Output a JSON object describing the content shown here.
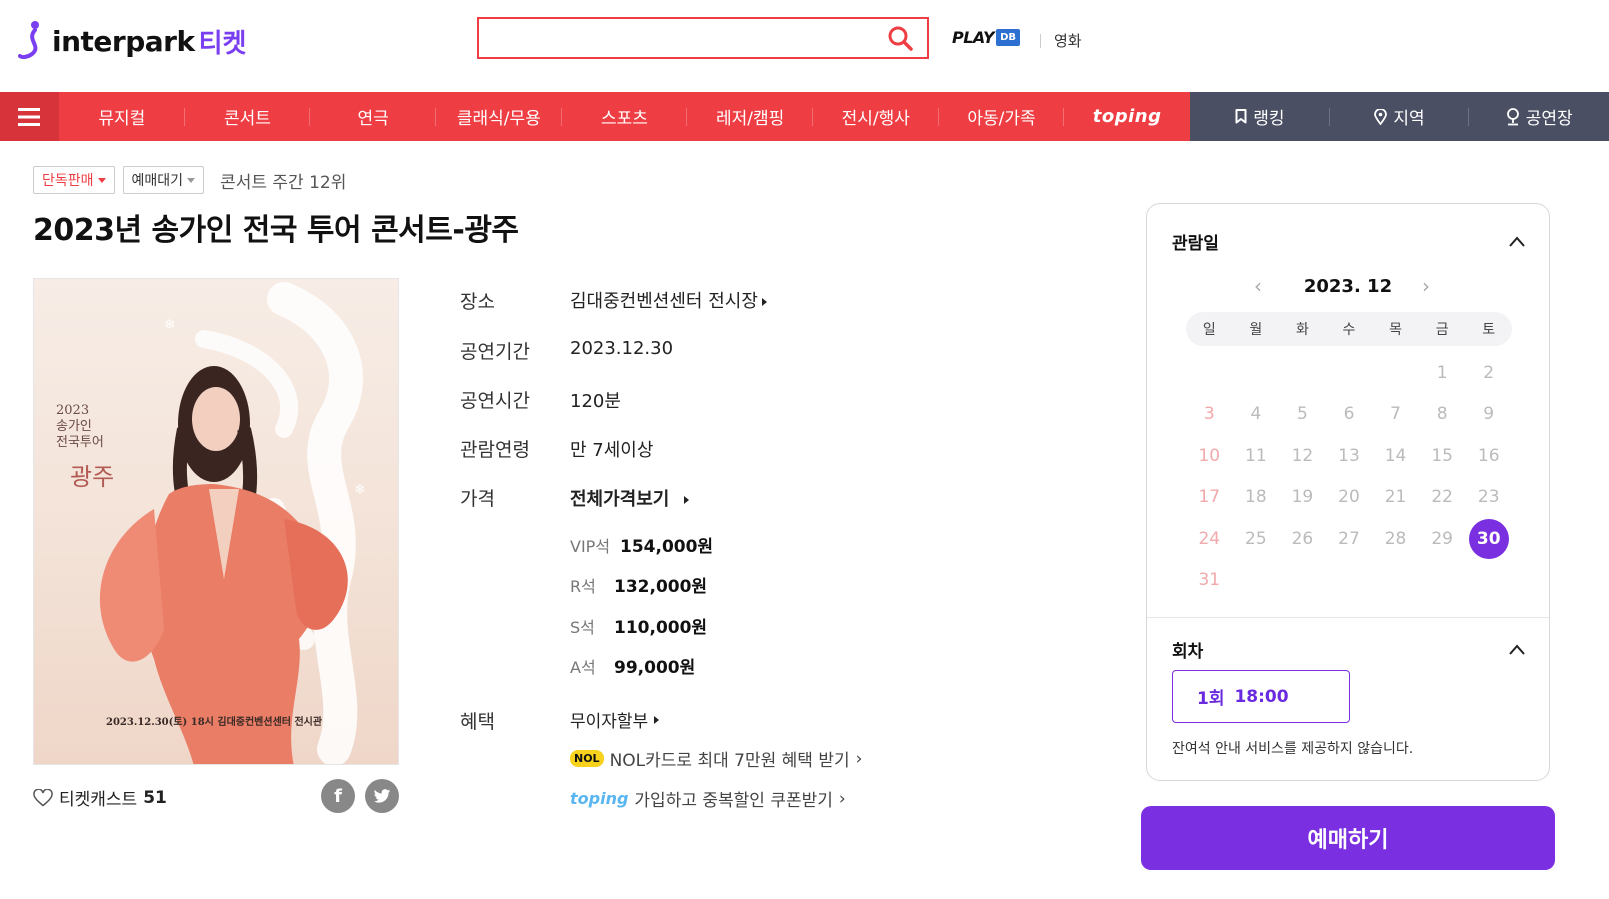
{
  "header": {
    "logo_text": "interpark",
    "logo_sub": "티켓",
    "search_placeholder": "",
    "playdb_text": "PLAY",
    "playdb_badge": "DB",
    "movie_label": "영화"
  },
  "nav": {
    "red_items": [
      "뮤지컬",
      "콘서트",
      "연극",
      "클래식/무용",
      "스포츠",
      "레저/캠핑",
      "전시/행사",
      "아동/가족",
      "toping"
    ],
    "dark_items": [
      "랭킹",
      "지역",
      "공연장"
    ]
  },
  "tags": {
    "exclusive": "단독판매",
    "waiting": "예매대기",
    "rank": "콘서트 주간 12위"
  },
  "title": "2023년 송가인 전국 투어 콘서트-광주",
  "poster": {
    "line1": "2023",
    "line2": "송가인",
    "line3": "전국투어",
    "city": "광주",
    "date_venue": "2023.12.30(토) 18시  김대중컨벤션센터 전시관"
  },
  "like": {
    "label": "티켓캐스트",
    "count": "51"
  },
  "info": {
    "venue_label": "장소",
    "venue_value": "김대중컨벤션센터 전시장",
    "period_label": "공연기간",
    "period_value": "2023.12.30",
    "time_label": "공연시간",
    "time_value": "120분",
    "age_label": "관람연령",
    "age_value": "만 7세이상",
    "price_label": "가격",
    "price_all": "전체가격보기",
    "prices": [
      {
        "seat": "VIP석",
        "price": "154,000원"
      },
      {
        "seat": "R석",
        "price": "132,000원"
      },
      {
        "seat": "S석",
        "price": "110,000원"
      },
      {
        "seat": "A석",
        "price": "99,000원"
      }
    ],
    "benefit_label": "혜택",
    "benefit_1": "무이자할부",
    "nol_badge": "NOL",
    "benefit_2": "NOL카드로 최대 7만원 혜택 받기",
    "toping_small": "toping",
    "benefit_3": "가입하고 중복할인 쿠폰받기"
  },
  "panel": {
    "date_heading": "관람일",
    "month": "2023. 12",
    "weekdays": [
      "일",
      "월",
      "화",
      "수",
      "목",
      "금",
      "토"
    ],
    "days": [
      "",
      "",
      "",
      "",
      "",
      "1",
      "2",
      "3",
      "4",
      "5",
      "6",
      "7",
      "8",
      "9",
      "10",
      "11",
      "12",
      "13",
      "14",
      "15",
      "16",
      "17",
      "18",
      "19",
      "20",
      "21",
      "22",
      "23",
      "24",
      "25",
      "26",
      "27",
      "28",
      "29",
      "30",
      "31"
    ],
    "selected_day": "30",
    "session_heading": "회차",
    "session_num": "1회",
    "session_time": "18:00",
    "notice": "잔여석 안내 서비스를 제공하지 않습니다."
  },
  "book_label": "예매하기",
  "colors": {
    "brand_red": "#ef3e43",
    "nav_dark": "#4a4f63",
    "accent_purple": "#7a2fe0"
  }
}
